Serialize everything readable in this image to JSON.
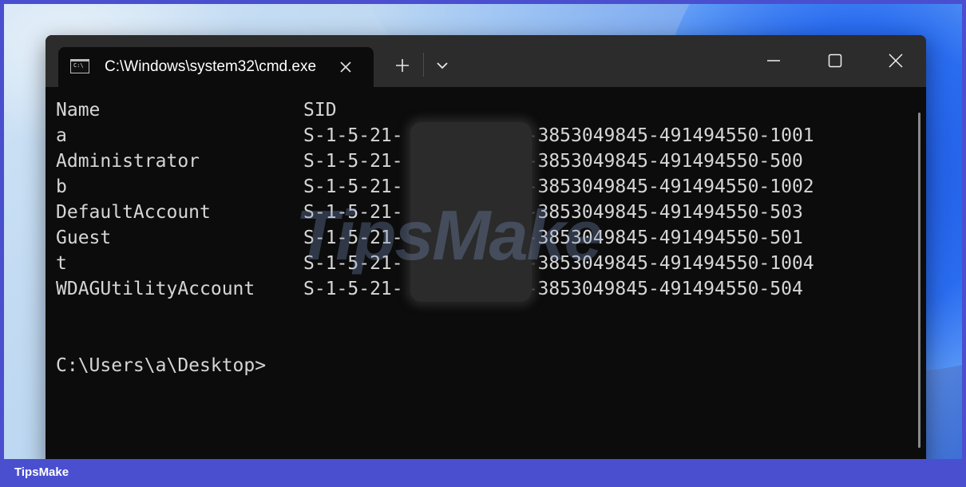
{
  "window": {
    "tab_title": "C:\\Windows\\system32\\cmd.exe",
    "tab_icon_text": "C:\\",
    "new_tab_label": "+"
  },
  "console": {
    "headers": {
      "name": "Name",
      "sid": "SID"
    },
    "rows": [
      {
        "name": "a",
        "sid_prefix": "S-1-5-21-",
        "sid_suffix": "-3853049845-491494550-1001"
      },
      {
        "name": "Administrator",
        "sid_prefix": "S-1-5-21-",
        "sid_suffix": "-3853049845-491494550-500"
      },
      {
        "name": "b",
        "sid_prefix": "S-1-5-21-",
        "sid_suffix": "-3853049845-491494550-1002"
      },
      {
        "name": "DefaultAccount",
        "sid_prefix": "S-1-5-21-",
        "sid_suffix": "-3853049845-491494550-503"
      },
      {
        "name": "Guest",
        "sid_prefix": "S-1-5-21-",
        "sid_suffix": "-3853049845-491494550-501"
      },
      {
        "name": "t",
        "sid_prefix": "S-1-5-21-",
        "sid_suffix": "-3853049845-491494550-1004"
      },
      {
        "name": "WDAGUtilityAccount",
        "sid_prefix": "S-1-5-21-",
        "sid_suffix": "-3853049845-491494550-504"
      }
    ],
    "prompt": "C:\\Users\\a\\Desktop>"
  },
  "watermark": "TipsMake",
  "footer": {
    "brand": "TipsMake"
  },
  "icons": {
    "tab": "cmd-icon",
    "close_tab": "close-icon",
    "new_tab": "plus-icon",
    "dropdown": "chevron-down-icon",
    "minimize": "minimize-icon",
    "maximize": "maximize-icon",
    "close_window": "close-icon"
  },
  "colors": {
    "console_bg": "#0c0c0c",
    "console_text": "#d6d6d6",
    "titlebar_bg": "#2c2c2c",
    "frame": "#4a4fcf"
  }
}
